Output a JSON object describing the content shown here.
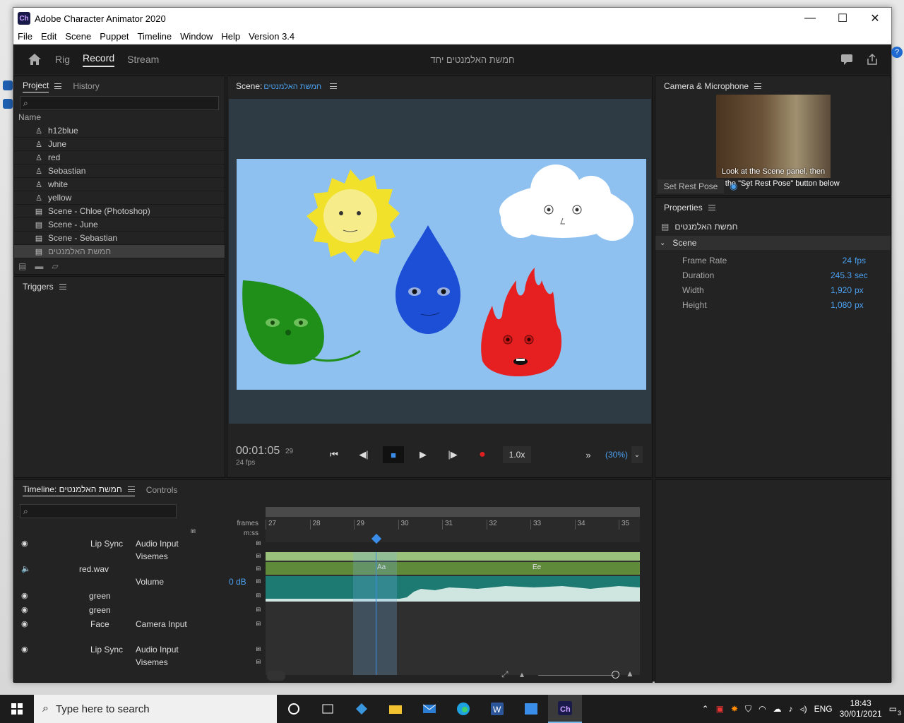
{
  "window": {
    "title": "Adobe Character Animator 2020",
    "controls": {
      "minimize": "—",
      "maximize": "☐",
      "close": "✕"
    }
  },
  "menu": [
    "File",
    "Edit",
    "Scene",
    "Puppet",
    "Timeline",
    "Window",
    "Help",
    "Version 3.4"
  ],
  "modes": {
    "tabs": [
      "Rig",
      "Record",
      "Stream"
    ],
    "active": "Record",
    "scene_title": "חמשת האלמנטים יחד"
  },
  "project": {
    "tab_project": "Project",
    "tab_history": "History",
    "column_name": "Name",
    "items": [
      {
        "label": "h12blue",
        "icon": "puppet-icon"
      },
      {
        "label": "June",
        "icon": "puppet-icon"
      },
      {
        "label": "red",
        "icon": "puppet-icon"
      },
      {
        "label": "Sebastian",
        "icon": "puppet-icon"
      },
      {
        "label": "white",
        "icon": "puppet-icon"
      },
      {
        "label": "yellow",
        "icon": "puppet-icon"
      },
      {
        "label": "Scene - Chloe (Photoshop)",
        "icon": "scene-icon"
      },
      {
        "label": "Scene - June",
        "icon": "scene-icon"
      },
      {
        "label": "Scene - Sebastian",
        "icon": "scene-icon"
      },
      {
        "label": "חמשת האלמנטים",
        "icon": "scene-icon",
        "selected": true
      }
    ]
  },
  "triggers": {
    "title": "Triggers"
  },
  "scene_panel": {
    "label": "Scene:",
    "scene_name": "חמשת האלמנטים",
    "timecode": "00:01:05",
    "frames": "29",
    "fps": "24 fps",
    "speed": "1.0x",
    "zoom": "(30%)"
  },
  "camera": {
    "title": "Camera & Microphone",
    "hint_line1": "Look at the Scene panel, then",
    "hint_line2": "click the \"Set Rest Pose\" button below",
    "set_rest_pose": "Set Rest Pose"
  },
  "properties": {
    "title": "Properties",
    "scene_name": "חמשת האלמנטים",
    "section": "Scene",
    "rows": [
      {
        "key": "Frame Rate",
        "value": "24",
        "unit": "fps"
      },
      {
        "key": "Duration",
        "value": "245.3",
        "unit": "sec"
      },
      {
        "key": "Width",
        "value": "1,920",
        "unit": "px"
      },
      {
        "key": "Height",
        "value": "1,080",
        "unit": "px"
      }
    ]
  },
  "timeline": {
    "tab": "Timeline: חמשת האלמנטים",
    "controls_tab": "Controls",
    "units_frames": "frames",
    "units_mss": "m:ss",
    "ticks": [
      "27",
      "28",
      "29",
      "30",
      "31",
      "32",
      "33",
      "34",
      "35"
    ],
    "rows": [
      {
        "name": "Lip Sync",
        "sub": "Audio Input"
      },
      {
        "name": "",
        "sub": "Visemes"
      },
      {
        "name": "red.wav",
        "sub": ""
      },
      {
        "name": "",
        "sub": "Volume",
        "value": "0 dB"
      },
      {
        "name": "green",
        "sub": ""
      },
      {
        "name": "green",
        "sub": ""
      },
      {
        "name": "Face",
        "sub": "Camera Input"
      },
      {
        "name": "Lip Sync",
        "sub": "Audio Input"
      },
      {
        "name": "",
        "sub": "Visemes"
      }
    ],
    "visemes": [
      "Aa",
      "Ee"
    ]
  },
  "taskbar": {
    "search_placeholder": "Type here to search",
    "language": "ENG",
    "time": "18:43",
    "date": "30/01/2021",
    "notifications": "3"
  }
}
